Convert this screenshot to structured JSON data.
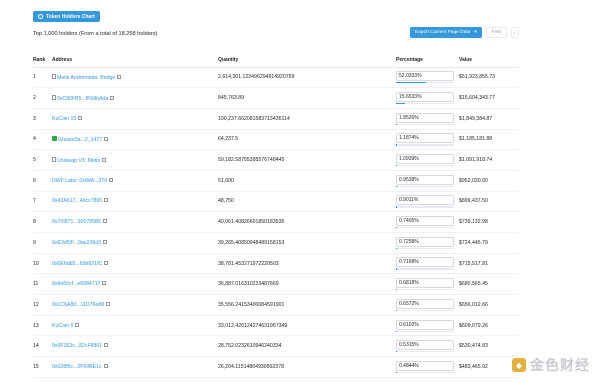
{
  "header": {
    "chart_button": "Token Holders Chart",
    "subtitle": "Top 1,000 holders (From a total of 18,258 holders)",
    "export_button": "Export Current Page Data",
    "first_button": "First",
    "more_button": "‹"
  },
  "table": {
    "columns": [
      "Rank",
      "Address",
      "Quantity",
      "Percentage",
      "Value"
    ],
    "rows": [
      {
        "rank": "1",
        "address": "Metis Andromeda: Bridge",
        "quantity": "2,614,301.123496294914920799",
        "percentage": "52.0203%",
        "pct": 52.0203,
        "value": "$51,923,855.73",
        "icon": "contract-icon"
      },
      {
        "rank": "2",
        "address": "0xC80FB5...fFb9bAda",
        "quantity": "845,763.89",
        "percentage": "15.6533%",
        "pct": 15.6533,
        "value": "$15,604,343.77",
        "icon": "contract-icon"
      },
      {
        "rank": "3",
        "address": "KuCoin 15",
        "quantity": "100,237.662081583713436114",
        "percentage": "1.8526%",
        "pct": 1.8526,
        "value": "$1,849,384.87",
        "icon": "none"
      },
      {
        "rank": "4",
        "address": "GnosisSa...2_1477",
        "quantity": "64,237.5",
        "percentage": "1.1874%",
        "pct": 1.1874,
        "value": "$1,185,181.88",
        "icon": "gnosis-icon"
      },
      {
        "rank": "5",
        "address": "Uniswap V3: Metis",
        "quantity": "59,182.58755395576748445",
        "percentage": "1.0939%",
        "pct": 1.0939,
        "value": "$1,091,918.74",
        "icon": "contract-icon"
      },
      {
        "rank": "6",
        "address": "DWF Labs: 0xddA...374",
        "quantity": "51,600",
        "percentage": "0.9538%",
        "pct": 0.9538,
        "value": "$952,020.00",
        "icon": "none"
      },
      {
        "rank": "7",
        "address": "0x43A617...49cc7865",
        "quantity": "48,750",
        "percentage": "0.9011%",
        "pct": 0.9011,
        "value": "$899,437.50",
        "icon": "none"
      },
      {
        "rank": "8",
        "address": "0x709f71...30078985",
        "quantity": "40,061.40826601850183536",
        "percentage": "0.7405%",
        "pct": 0.7405,
        "value": "$739,132.98",
        "icon": "none"
      },
      {
        "rank": "9",
        "address": "0xE3df2F...0ae236d3",
        "quantity": "39,265.40850948489158153",
        "percentage": "0.7258%",
        "pct": 0.7258,
        "value": "$724,446.79",
        "icon": "none"
      },
      {
        "rank": "10",
        "address": "0x6E6db5...69b921fC",
        "quantity": "38,781.453271972220503",
        "percentage": "0.7168%",
        "pct": 0.7168,
        "value": "$715,517.81",
        "icon": "none"
      },
      {
        "rank": "11",
        "address": "0x6e60cf...e6084717",
        "quantity": "36,887.016310223487669",
        "percentage": "0.6818%",
        "pct": 0.6818,
        "value": "$680,565.45",
        "icon": "none"
      },
      {
        "rank": "12",
        "address": "0x1C6A80...11D76e88",
        "quantity": "35,556.24153400084591901",
        "percentage": "0.6572%",
        "pct": 0.6572,
        "value": "$656,012.66",
        "icon": "none"
      },
      {
        "rank": "13",
        "address": "KuCoin 6",
        "quantity": "33,012.426124274631967349",
        "percentage": "0.6102%",
        "pct": 0.6102,
        "value": "$609,079.26",
        "icon": "none"
      },
      {
        "rank": "14",
        "address": "0x9F263c...82cF8861",
        "quantity": "28,752.0232610946240334",
        "percentage": "0.5315%",
        "pct": 0.5315,
        "value": "$530,474.83",
        "icon": "none"
      },
      {
        "rank": "15",
        "address": "0x028f5c...2F59BE1c",
        "quantity": "26,204.11514804930562378",
        "percentage": "0.4844%",
        "pct": 0.4844,
        "value": "$483,465.92",
        "icon": "none"
      }
    ]
  },
  "watermark": {
    "text": "金色财经"
  },
  "colors": {
    "accent": "#3498db",
    "border": "#e7eaf3",
    "text": "#1e2022",
    "muted": "#8c98a4"
  }
}
